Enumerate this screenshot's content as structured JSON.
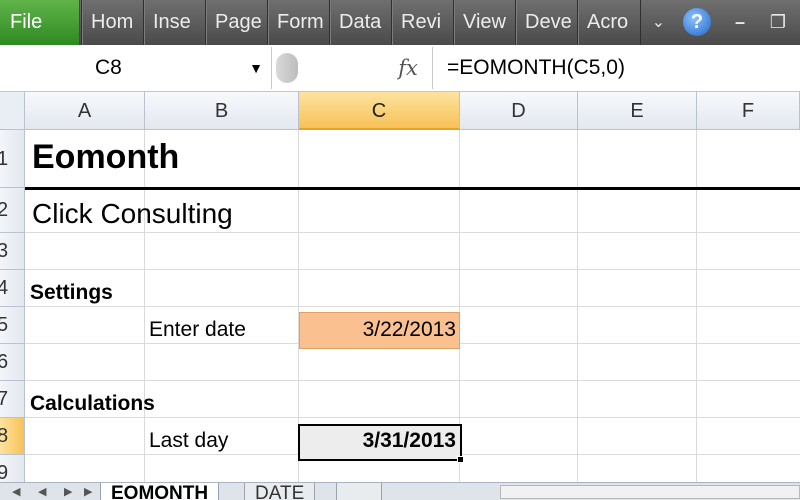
{
  "ribbon": {
    "file_label": "File",
    "tabs": [
      "Hom",
      "Inse",
      "Page",
      "Form",
      "Data",
      "Revi",
      "View",
      "Deve",
      "Acro"
    ],
    "help_icon": "?",
    "minimize_icon": "–",
    "restore_icon": "❐"
  },
  "formula_bar": {
    "name_box": "C8",
    "fx_label": "fx",
    "formula": "=EOMONTH(C5,0)"
  },
  "columns": [
    "A",
    "B",
    "C",
    "D",
    "E",
    "F"
  ],
  "rows": [
    "1",
    "2",
    "3",
    "4",
    "5",
    "6",
    "7",
    "8",
    "9"
  ],
  "cells": {
    "a1": "Eomonth",
    "a2": "Click Consulting",
    "a4": "Settings",
    "b5": "Enter date",
    "c5": "3/22/2013",
    "a7": "Calculations",
    "b8": "Last day",
    "c8": "3/31/2013"
  },
  "sheet_tabs": [
    "EOMONTH",
    "DATE"
  ],
  "colors": {
    "input_cell": "#fac090",
    "selected_header": "#f7c257",
    "file_tab": "#2f8a22"
  }
}
